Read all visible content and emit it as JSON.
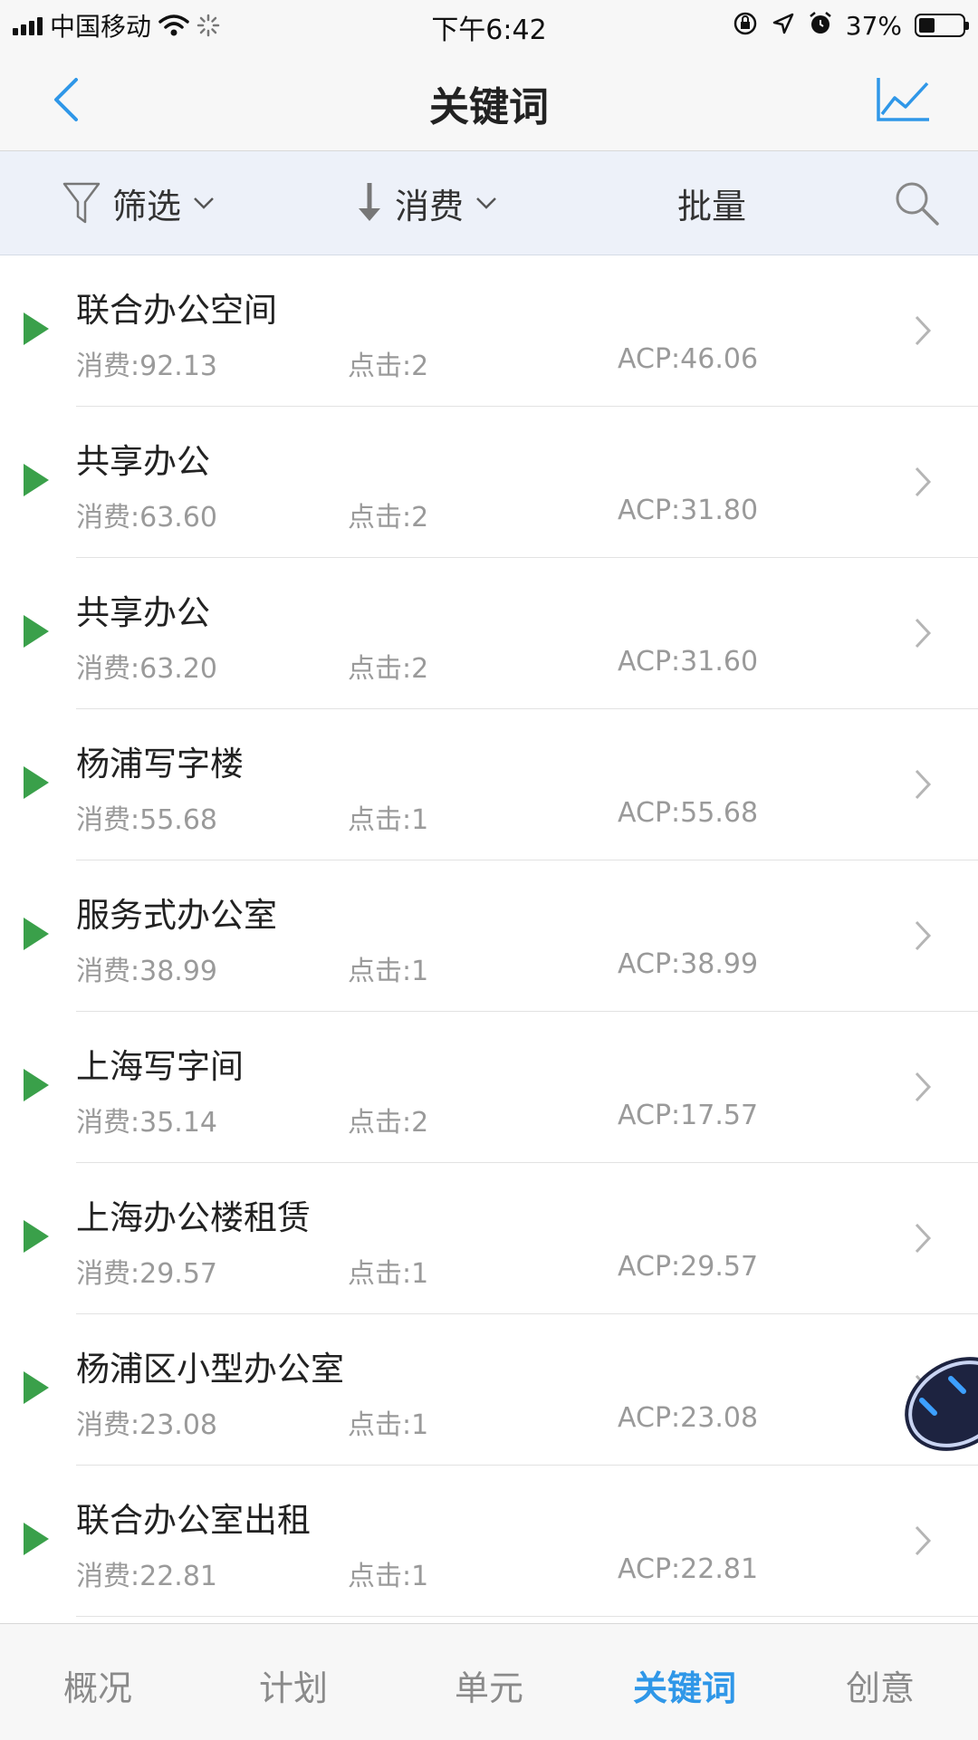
{
  "status_bar": {
    "carrier": "中国移动",
    "time": "下午6:42",
    "battery": "37%",
    "battery_level": 0.37
  },
  "nav": {
    "title": "关键词",
    "back_icon": "chevron-left-icon",
    "right_icon": "line-chart-icon"
  },
  "filter_bar": {
    "filter_label": "筛选",
    "sort_label": "消费",
    "batch_label": "批量",
    "search_icon": "search-icon"
  },
  "keywords": [
    {
      "name": "联合办公空间",
      "spend": "消费:92.13",
      "clicks": "点击:2",
      "acp": "ACP:46.06"
    },
    {
      "name": "共享办公",
      "spend": "消费:63.60",
      "clicks": "点击:2",
      "acp": "ACP:31.80"
    },
    {
      "name": "共享办公",
      "spend": "消费:63.20",
      "clicks": "点击:2",
      "acp": "ACP:31.60"
    },
    {
      "name": "杨浦写字楼",
      "spend": "消费:55.68",
      "clicks": "点击:1",
      "acp": "ACP:55.68"
    },
    {
      "name": "服务式办公室",
      "spend": "消费:38.99",
      "clicks": "点击:1",
      "acp": "ACP:38.99"
    },
    {
      "name": "上海写字间",
      "spend": "消费:35.14",
      "clicks": "点击:2",
      "acp": "ACP:17.57"
    },
    {
      "name": "上海办公楼租赁",
      "spend": "消费:29.57",
      "clicks": "点击:1",
      "acp": "ACP:29.57"
    },
    {
      "name": "杨浦区小型办公室",
      "spend": "消费:23.08",
      "clicks": "点击:1",
      "acp": "ACP:23.08"
    },
    {
      "name": "联合办公室出租",
      "spend": "消费:22.81",
      "clicks": "点击:1",
      "acp": "ACP:22.81"
    }
  ],
  "tabs": [
    {
      "label": "概况",
      "active": false
    },
    {
      "label": "计划",
      "active": false
    },
    {
      "label": "单元",
      "active": false
    },
    {
      "label": "关键词",
      "active": true
    },
    {
      "label": "创意",
      "active": false
    }
  ],
  "colors": {
    "accent": "#2f97e8",
    "play": "#3aa04a",
    "filter_bar_bg": "#edf1f9"
  }
}
